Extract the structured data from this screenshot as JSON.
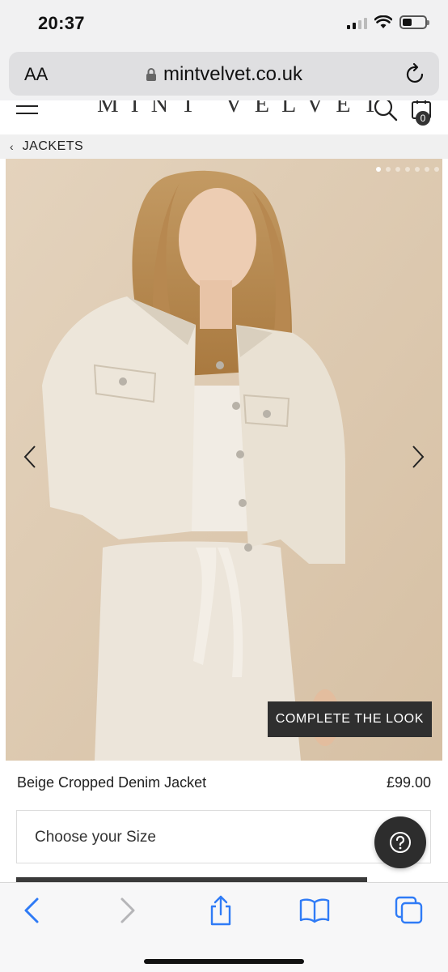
{
  "status_bar": {
    "time": "20:37"
  },
  "browser": {
    "text_size_label": "AA",
    "url": "mintvelvet.co.uk"
  },
  "site": {
    "logo": "MINT VELVET",
    "bag_count": "0"
  },
  "breadcrumb": {
    "label": "JACKETS"
  },
  "gallery": {
    "image_count": 7,
    "active_index": 0,
    "complete_look_label": "COMPLETE THE LOOK"
  },
  "product": {
    "name": "Beige Cropped Denim Jacket",
    "price": "£99.00",
    "size_placeholder": "Choose your Size"
  },
  "colors": {
    "accent_dark": "#2f2f2f",
    "ios_blue": "#2f7bf6",
    "image_bg": "#ddc9b0"
  }
}
